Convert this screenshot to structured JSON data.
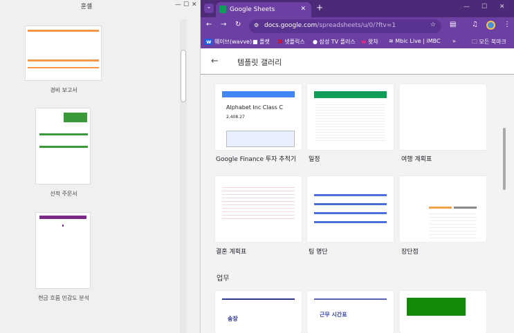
{
  "left_panel": {
    "title": "훈셸",
    "controls": {
      "minimize": "—",
      "maximize": "☐",
      "close": "✕"
    },
    "templates": [
      {
        "label": "경비 보고서"
      },
      {
        "label": "선적 주문서"
      },
      {
        "label": "현금 흐름 민감도 분석"
      }
    ]
  },
  "browser": {
    "tab_title": "Google Sheets",
    "url_host": "docs.google.com",
    "url_path": "/spreadsheets/u/0/?ftv=1",
    "bookmarks": [
      "웨이브(wavve)",
      "플랫",
      "넷플릭스",
      "삼성 TV 플러스",
      "왓챠",
      "Mbic Live | iMBC"
    ],
    "all_bookmarks": "모든 북마크"
  },
  "gallery": {
    "title": "템플릿 갤러리",
    "personal": [
      {
        "label": "Google Finance 투자 추적기",
        "preview_title": "Alphabet Inc Class C",
        "preview_price": "2,408.27"
      },
      {
        "label": "일정"
      },
      {
        "label": "여행 계획표"
      },
      {
        "label": "결혼 계획표"
      },
      {
        "label": "팀 명단"
      },
      {
        "label": "장단점"
      }
    ],
    "section_work": "업무",
    "work_previews": [
      "송장",
      "근무 시간표"
    ]
  },
  "colors": {
    "chrome": "#6c3fa3",
    "tabstrip": "#4d2a78"
  }
}
